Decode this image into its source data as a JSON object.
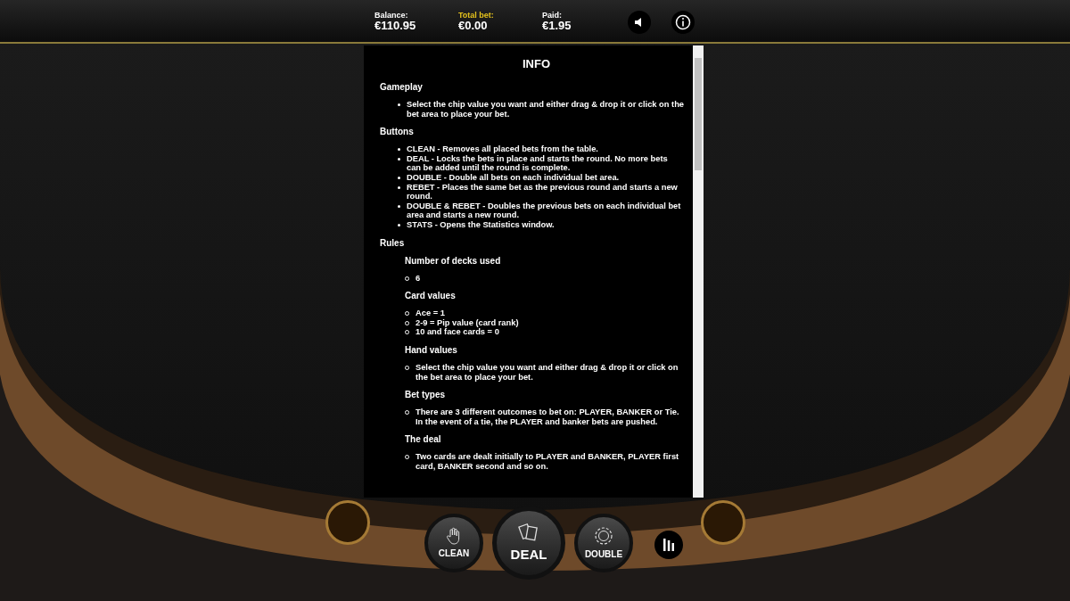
{
  "header": {
    "stats": [
      {
        "label": "Balance:",
        "value": "€110.95",
        "highlighted": false
      },
      {
        "label": "Total bet:",
        "value": "€0.00",
        "highlighted": true
      },
      {
        "label": "Paid:",
        "value": "€1.95",
        "highlighted": false
      }
    ]
  },
  "info": {
    "title": "INFO",
    "sections": [
      {
        "heading": "Gameplay",
        "items": [
          "Select the chip value you want and either drag & drop it or click on the bet area to place your bet."
        ]
      },
      {
        "heading": "Buttons",
        "items": [
          "CLEAN - Removes all placed bets from the table.",
          "DEAL - Locks the bets in place and starts the round. No more bets can be added until the round is complete.",
          "DOUBLE - Double all bets on each individual bet area.",
          "REBET - Places the same bet as the previous round and starts a new round.",
          "DOUBLE & REBET - Doubles the previous bets on each individual bet area and starts a new round.",
          "STATS - Opens the Statistics window."
        ]
      },
      {
        "heading": "Rules",
        "subsections": [
          {
            "heading": "Number of decks used",
            "items": [
              "6"
            ]
          },
          {
            "heading": "Card values",
            "items": [
              "Ace = 1",
              "2-9 = Pip value (card rank)",
              "10 and face cards = 0"
            ]
          },
          {
            "heading": "Hand values",
            "items": [
              "Select the chip value you want and either drag & drop it or click on the bet area to place your bet."
            ]
          },
          {
            "heading": "Bet types",
            "items": [
              "There are 3 different outcomes to bet on: PLAYER, BANKER or Tie. In the event of a tie, the PLAYER and banker bets are pushed."
            ]
          },
          {
            "heading": "The deal",
            "items": [
              "Two cards are dealt initially to PLAYER and BANKER, PLAYER first card, BANKER second and so on."
            ]
          }
        ]
      }
    ]
  },
  "controls": [
    {
      "label": "CLEAN",
      "kind": "clean"
    },
    {
      "label": "DEAL",
      "kind": "deal"
    },
    {
      "label": "DOUBLE",
      "kind": "double"
    }
  ]
}
